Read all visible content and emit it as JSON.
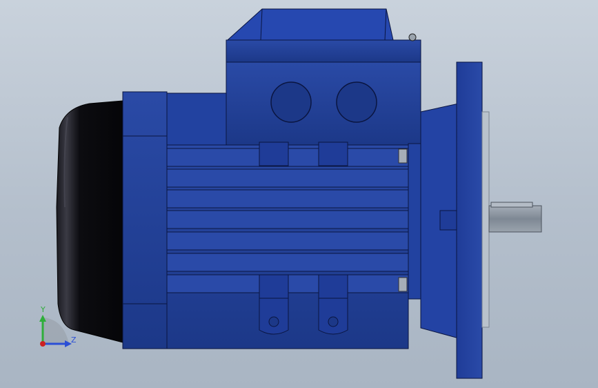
{
  "viewport": {
    "background_top": "#c9d2dc",
    "background_bottom": "#a9b5c3"
  },
  "model": {
    "description_icon": "electric-motor-3d-model",
    "body_color": "#22409a",
    "body_dark_color": "#16307a",
    "outline_color": "#0a1540",
    "fan_cover_color": "#0d0d12",
    "shaft_color": "#8e98a4",
    "flange_face_color": "#b9c2cc"
  },
  "triad": {
    "y_label": "Y",
    "z_label": "Z",
    "y_color": "#2fae3a",
    "z_color": "#2b4fd6",
    "origin_color": "#cc2222"
  }
}
